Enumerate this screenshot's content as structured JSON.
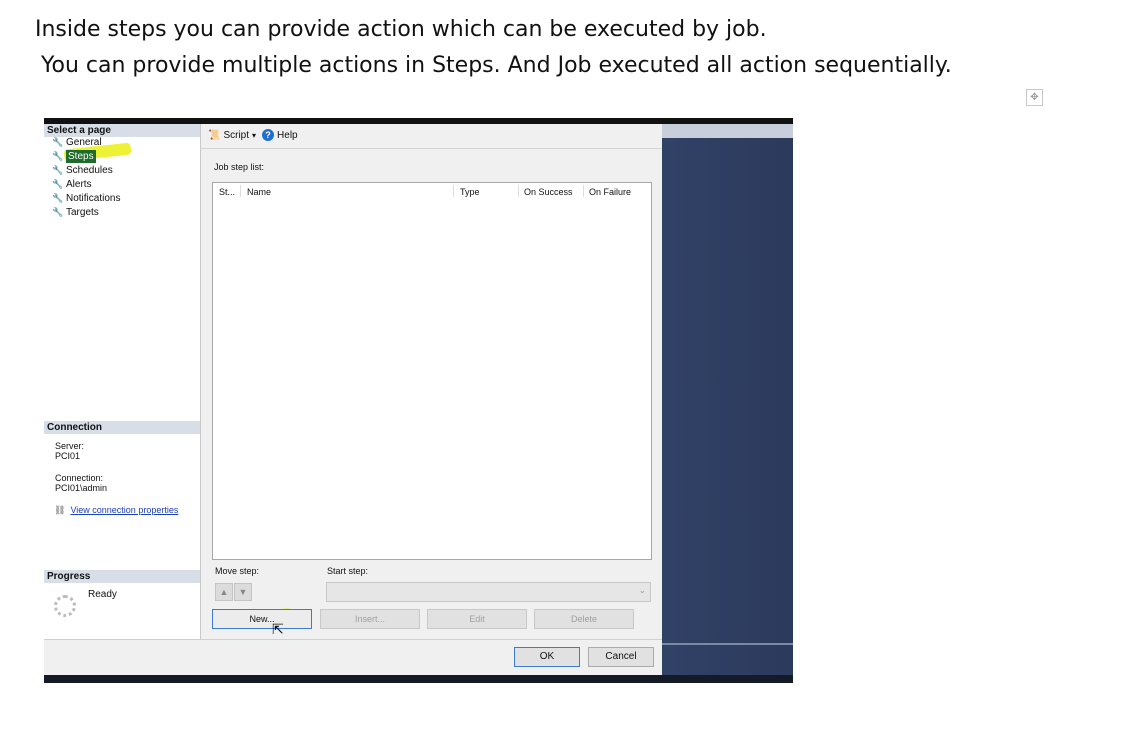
{
  "doc": {
    "line1": "Inside steps you can provide action which can be executed by job.",
    "line2": "You can provide multiple actions in Steps. And Job executed all action sequentially."
  },
  "dialog": {
    "left_pane": {
      "select_page_header": "Select a page",
      "pages": [
        {
          "label": "General",
          "icon": "wrench-icon"
        },
        {
          "label": "Steps",
          "icon": "wrench-icon",
          "selected": true
        },
        {
          "label": "Schedules",
          "icon": "wrench-icon"
        },
        {
          "label": "Alerts",
          "icon": "wrench-icon"
        },
        {
          "label": "Notifications",
          "icon": "wrench-icon"
        },
        {
          "label": "Targets",
          "icon": "wrench-icon"
        }
      ],
      "connection_header": "Connection",
      "server_label": "Server:",
      "server_value": "PCI01",
      "connection_label": "Connection:",
      "connection_value": "PCI01\\admin",
      "view_connection_link": "View connection properties",
      "progress_header": "Progress",
      "progress_status": "Ready"
    },
    "toolbar": {
      "script_label": "Script",
      "help_label": "Help"
    },
    "job_step_list_label": "Job step list:",
    "columns": [
      "St...",
      "Name",
      "Type",
      "On Success",
      "On Failure"
    ],
    "move_step_label": "Move step:",
    "start_step_label": "Start step:",
    "buttons": {
      "new": "New...",
      "insert": "Insert...",
      "edit": "Edit",
      "delete": "Delete",
      "ok": "OK",
      "cancel": "Cancel"
    },
    "highlight_color": "#ebf014"
  }
}
